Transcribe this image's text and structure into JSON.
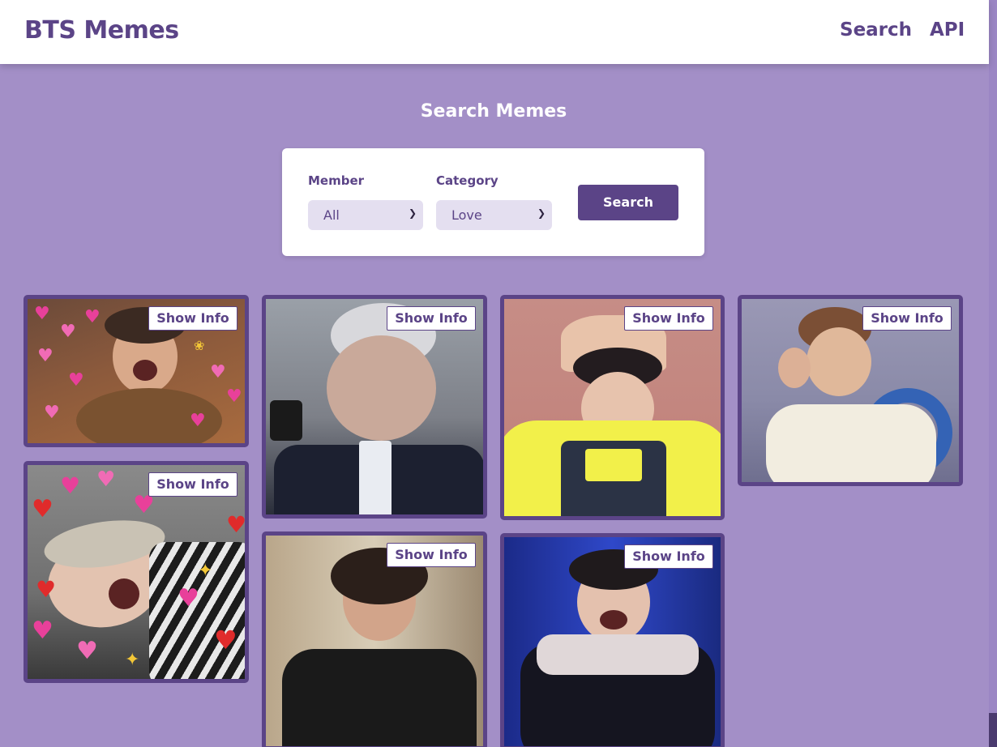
{
  "brand": "BTS Memes",
  "nav": {
    "search": "Search",
    "api": "API"
  },
  "page_title": "Search Memes",
  "search_form": {
    "member_label": "Member",
    "member_value": "All",
    "category_label": "Category",
    "category_value": "Love",
    "submit_label": "Search"
  },
  "meme_card": {
    "info_label": "Show Info"
  },
  "colors": {
    "brand": "#5b4487",
    "background": "#a38fc7",
    "select_bg": "#e4dff0"
  }
}
